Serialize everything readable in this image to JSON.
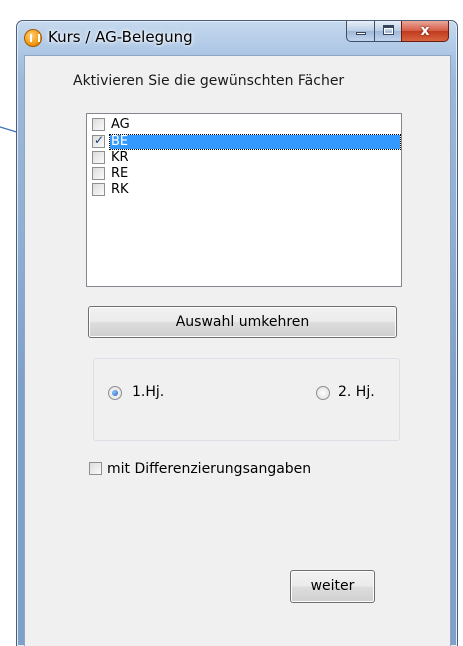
{
  "window": {
    "title": "Kurs / AG-Belegung",
    "close_glyph": "x"
  },
  "dialog": {
    "instruction": "Aktivieren Sie die gewünschten Fächer",
    "subjects": [
      {
        "label": "AG",
        "checked": false,
        "selected": false
      },
      {
        "label": "BE",
        "checked": true,
        "selected": true
      },
      {
        "label": "KR",
        "checked": false,
        "selected": false
      },
      {
        "label": "RE",
        "checked": false,
        "selected": false
      },
      {
        "label": "RK",
        "checked": false,
        "selected": false
      }
    ],
    "invert_button": "Auswahl umkehren",
    "half_year": {
      "option1": "1.Hj.",
      "option2": "2. Hj.",
      "selected": "option1"
    },
    "differentiation_label": "mit Differenzierungsangaben",
    "differentiation_checked": false,
    "next_button": "weiter"
  },
  "colors": {
    "selection": "#3399ff",
    "annotation_arrow": "#3a6fb6"
  }
}
